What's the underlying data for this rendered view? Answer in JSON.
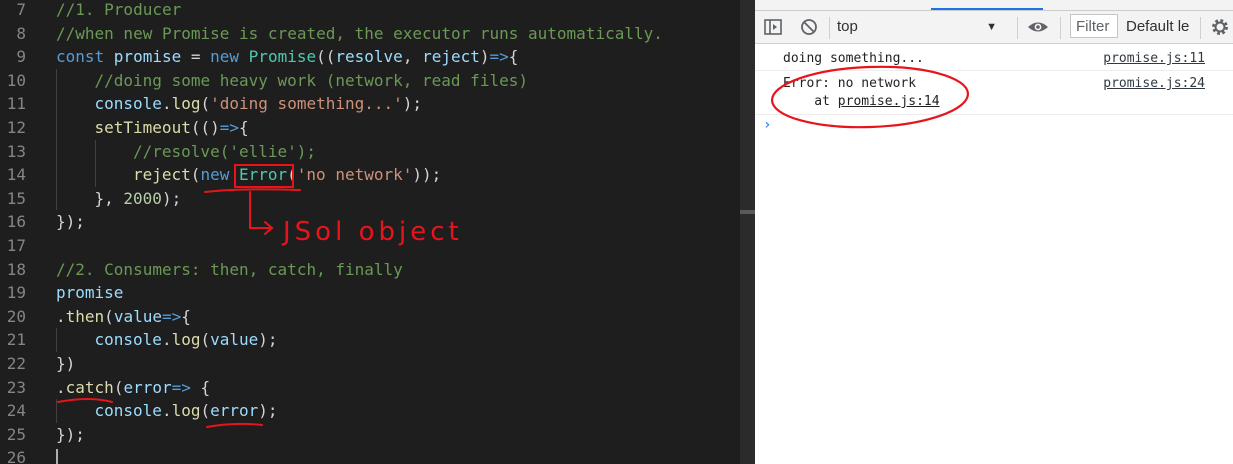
{
  "editor": {
    "lines": [
      {
        "n": "7",
        "indent": 0,
        "tokens": [
          [
            "cm",
            "//1. Producer"
          ]
        ]
      },
      {
        "n": "8",
        "indent": 0,
        "tokens": [
          [
            "cm",
            "//when new Promise is created, the executor runs automatically."
          ]
        ]
      },
      {
        "n": "9",
        "indent": 0,
        "tokens": [
          [
            "kw",
            "const "
          ],
          [
            "vr",
            "promise"
          ],
          [
            "pn",
            " = "
          ],
          [
            "kw",
            "new "
          ],
          [
            "ty",
            "Promise"
          ],
          [
            "pn",
            "(("
          ],
          [
            "vr",
            "resolve"
          ],
          [
            "pn",
            ", "
          ],
          [
            "vr",
            "reject"
          ],
          [
            "pn",
            ")"
          ],
          [
            "kw",
            "=>"
          ],
          [
            "pn",
            "{"
          ]
        ]
      },
      {
        "n": "10",
        "indent": 1,
        "tokens": [
          [
            "cm",
            "//doing some heavy work (network, read files)"
          ]
        ]
      },
      {
        "n": "11",
        "indent": 1,
        "tokens": [
          [
            "vr",
            "console"
          ],
          [
            "pn",
            "."
          ],
          [
            "fn",
            "log"
          ],
          [
            "pn",
            "("
          ],
          [
            "st",
            "'doing something...'"
          ],
          [
            "pn",
            ");"
          ]
        ]
      },
      {
        "n": "12",
        "indent": 1,
        "tokens": [
          [
            "fn",
            "setTimeout"
          ],
          [
            "pn",
            "(()"
          ],
          [
            "kw",
            "=>"
          ],
          [
            "pn",
            "{"
          ]
        ]
      },
      {
        "n": "13",
        "indent": 2,
        "tokens": [
          [
            "cm",
            "//resolve('ellie');"
          ]
        ]
      },
      {
        "n": "14",
        "indent": 2,
        "tokens": [
          [
            "fn",
            "reject"
          ],
          [
            "pn",
            "("
          ],
          [
            "kw",
            "new "
          ],
          [
            "ty",
            "Error"
          ],
          [
            "pn",
            "("
          ],
          [
            "st",
            "'no network'"
          ],
          [
            "pn",
            "));"
          ]
        ]
      },
      {
        "n": "15",
        "indent": 1,
        "tokens": [
          [
            "pn",
            "}, "
          ],
          [
            "nm",
            "2000"
          ],
          [
            "pn",
            ");"
          ]
        ]
      },
      {
        "n": "16",
        "indent": 0,
        "tokens": [
          [
            "pn",
            "});"
          ]
        ]
      },
      {
        "n": "17",
        "indent": 0,
        "tokens": []
      },
      {
        "n": "18",
        "indent": 0,
        "tokens": [
          [
            "cm",
            "//2. Consumers: then, catch, finally"
          ]
        ]
      },
      {
        "n": "19",
        "indent": 0,
        "tokens": [
          [
            "vr",
            "promise"
          ]
        ]
      },
      {
        "n": "20",
        "indent": 0,
        "tokens": [
          [
            "pn",
            "."
          ],
          [
            "fn",
            "then"
          ],
          [
            "pn",
            "("
          ],
          [
            "vr",
            "value"
          ],
          [
            "kw",
            "=>"
          ],
          [
            "pn",
            "{"
          ]
        ]
      },
      {
        "n": "21",
        "indent": 1,
        "tokens": [
          [
            "vr",
            "console"
          ],
          [
            "pn",
            "."
          ],
          [
            "fn",
            "log"
          ],
          [
            "pn",
            "("
          ],
          [
            "vr",
            "value"
          ],
          [
            "pn",
            ");"
          ]
        ]
      },
      {
        "n": "22",
        "indent": 0,
        "tokens": [
          [
            "pn",
            "})"
          ]
        ]
      },
      {
        "n": "23",
        "indent": 0,
        "tokens": [
          [
            "pn",
            "."
          ],
          [
            "fn",
            "catch"
          ],
          [
            "pn",
            "("
          ],
          [
            "vr",
            "error"
          ],
          [
            "kw",
            "=> "
          ],
          [
            "pn",
            "{"
          ]
        ]
      },
      {
        "n": "24",
        "indent": 1,
        "tokens": [
          [
            "vr",
            "console"
          ],
          [
            "pn",
            "."
          ],
          [
            "fn",
            "log"
          ],
          [
            "pn",
            "("
          ],
          [
            "vr",
            "error"
          ],
          [
            "pn",
            ");"
          ]
        ]
      },
      {
        "n": "25",
        "indent": 0,
        "tokens": [
          [
            "pn",
            "});"
          ]
        ]
      },
      {
        "n": "26",
        "indent": 0,
        "tokens": []
      }
    ]
  },
  "devtools": {
    "toolbar": {
      "context": "top",
      "filter_placeholder": "Filter",
      "levels": "Default le"
    },
    "messages": [
      {
        "text": "doing something...",
        "source": "promise.js:11"
      },
      {
        "text": "Error: no network",
        "detail_prefix": "    at ",
        "detail_link": "promise.js:14",
        "source": "promise.js:24"
      }
    ],
    "prompt": "›"
  },
  "annotations": {
    "handwritten_note": "JSol object"
  },
  "colors": {
    "editor_bg": "#1e1e1e",
    "annotation_red": "#e8141c",
    "devtools_accent": "#1a73e8"
  }
}
